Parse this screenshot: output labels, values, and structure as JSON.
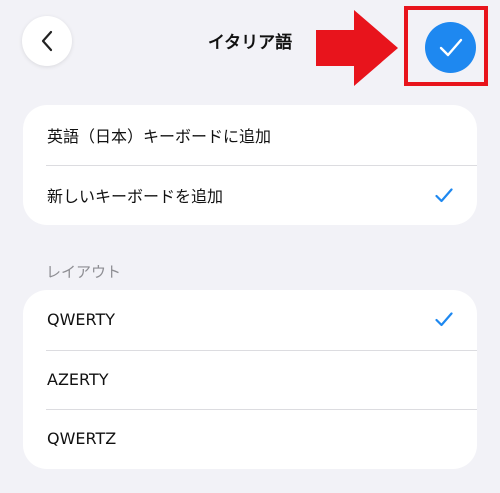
{
  "header": {
    "title": "イタリア語"
  },
  "keyboard_options": [
    {
      "label": "英語（日本）キーボードに追加",
      "checked": false
    },
    {
      "label": "新しいキーボードを追加",
      "checked": true
    }
  ],
  "layout_section": {
    "label": "レイアウト",
    "items": [
      {
        "label": "QWERTY",
        "checked": true
      },
      {
        "label": "AZERTY",
        "checked": false
      },
      {
        "label": "QWERTZ",
        "checked": false
      }
    ]
  },
  "colors": {
    "accent": "#1e88f0",
    "annotation_red": "#e8141c",
    "background": "#f2f2f7"
  }
}
